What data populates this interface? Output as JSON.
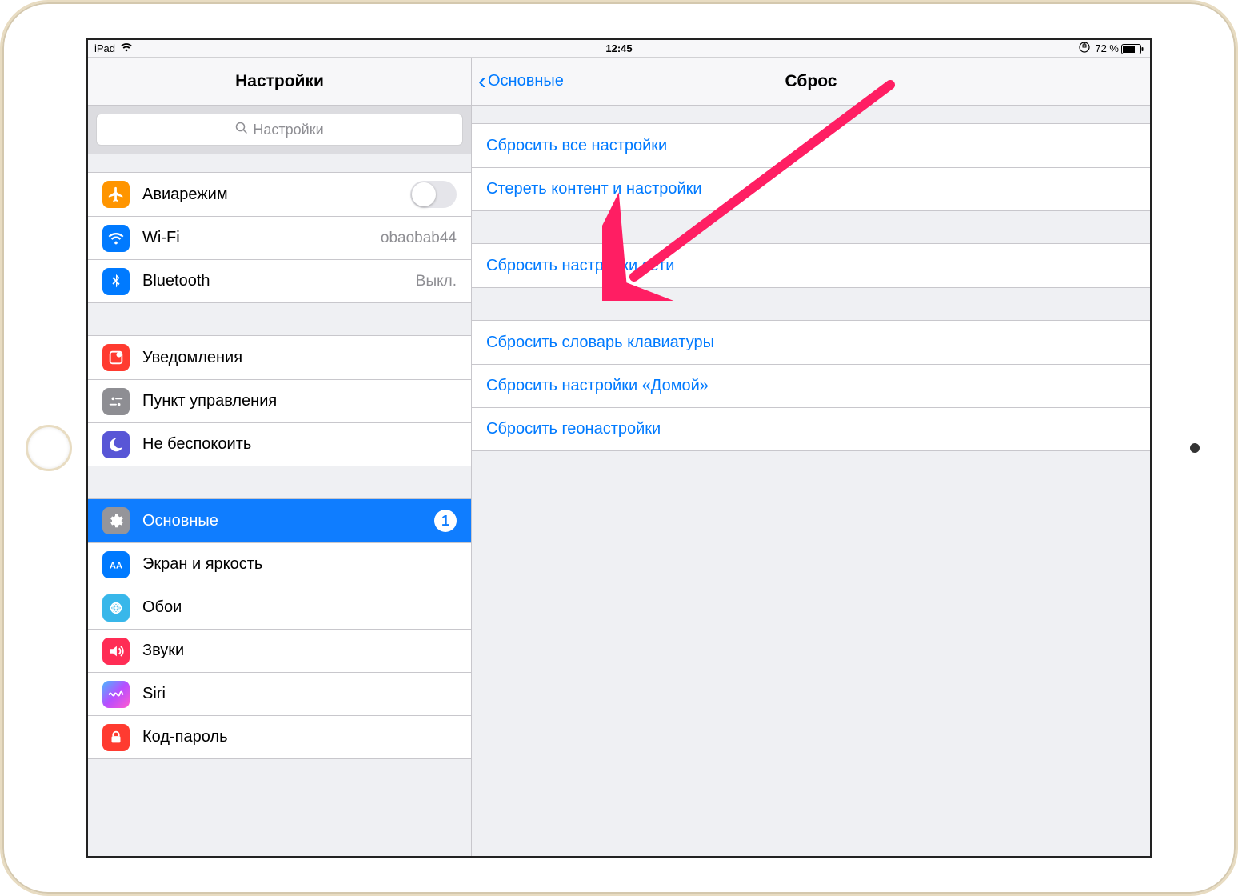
{
  "status": {
    "device": "iPad",
    "time": "12:45",
    "battery_text": "72 %"
  },
  "sidebar": {
    "title": "Настройки",
    "search_placeholder": "Настройки",
    "groups": [
      {
        "rows": [
          {
            "key": "airplane",
            "label": "Авиарежим",
            "ctrl": "toggle"
          },
          {
            "key": "wifi",
            "label": "Wi-Fi",
            "value": "obaobab44"
          },
          {
            "key": "bt",
            "label": "Bluetooth",
            "value": "Выкл."
          }
        ]
      },
      {
        "rows": [
          {
            "key": "notif",
            "label": "Уведомления"
          },
          {
            "key": "cc",
            "label": "Пункт управления"
          },
          {
            "key": "dnd",
            "label": "Не беспокоить"
          }
        ]
      },
      {
        "rows": [
          {
            "key": "general",
            "label": "Основные",
            "selected": true,
            "badge": "1"
          },
          {
            "key": "display",
            "label": "Экран и яркость"
          },
          {
            "key": "wallpaper",
            "label": "Обои"
          },
          {
            "key": "sounds",
            "label": "Звуки"
          },
          {
            "key": "siri",
            "label": "Siri"
          },
          {
            "key": "passcode",
            "label": "Код-пароль"
          }
        ]
      }
    ]
  },
  "detail": {
    "back_label": "Основные",
    "title": "Сброс",
    "groups": [
      {
        "rows": [
          {
            "label": "Сбросить все настройки"
          },
          {
            "label": "Стереть контент и настройки"
          }
        ]
      },
      {
        "rows": [
          {
            "label": "Сбросить настройки сети"
          }
        ]
      },
      {
        "rows": [
          {
            "label": "Сбросить словарь клавиатуры"
          },
          {
            "label": "Сбросить настройки «Домой»"
          },
          {
            "label": "Сбросить геонастройки"
          }
        ]
      }
    ]
  },
  "annotation": {
    "arrow_color": "#ff1e63"
  }
}
